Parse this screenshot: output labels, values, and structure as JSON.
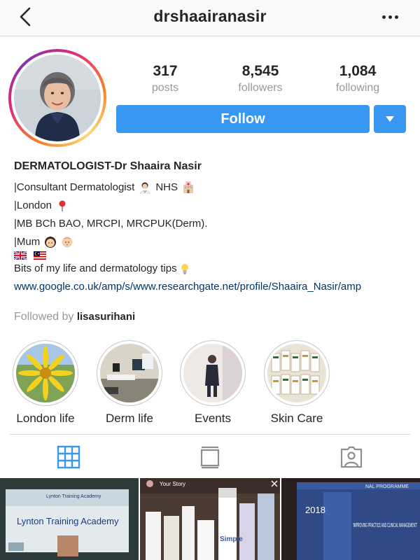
{
  "header": {
    "username": "drshaairanasir"
  },
  "stats": [
    {
      "value": "317",
      "label": "posts"
    },
    {
      "value": "8,545",
      "label": "followers"
    },
    {
      "value": "1,084",
      "label": "following"
    }
  ],
  "actions": {
    "follow_label": "Follow"
  },
  "bio": {
    "name": "DERMATOLOGIST-Dr Shaaira Nasir",
    "line1_a": "|Consultant Dermatologist",
    "line1_b": "NHS",
    "line2": "|London",
    "line3": "|MB BCh BAO, MRCPI, MRCPUK(Derm).",
    "line4": "|Mum",
    "tagline": "Bits of my life and dermatology tips",
    "link": "www.google.co.uk/amp/s/www.researchgate.net/profile/Shaaira_Nasir/amp",
    "followed_by_prefix": "Followed by",
    "followed_by_user": "lisasurihani"
  },
  "highlights": [
    {
      "label": "London life"
    },
    {
      "label": "Derm life"
    },
    {
      "label": "Events"
    },
    {
      "label": "Skin Care"
    }
  ],
  "posts": {
    "post1": {
      "title_small": "Lynton Training Academy",
      "title": "Lynton Training Academy"
    },
    "post2": {
      "story_label": "Your Story",
      "brand": "Simple"
    },
    "post3": {
      "heading": "NAL PROGRAMME",
      "year": "2018",
      "quote": "'IMPROVING PRACTICE AND CLINICAL MANAGEMENT'"
    }
  },
  "colors": {
    "accent": "#3897f0",
    "link": "#003569",
    "muted": "#999999"
  }
}
